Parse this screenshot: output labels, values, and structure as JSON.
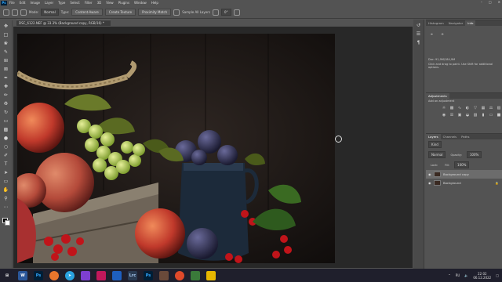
{
  "menubar": {
    "logo": "Ps",
    "items": [
      "File",
      "Edit",
      "Image",
      "Layer",
      "Type",
      "Select",
      "Filter",
      "3D",
      "View",
      "Plugins",
      "Window",
      "Help"
    ]
  },
  "options": {
    "mode_label": "Mode:",
    "mode_value": "Normal",
    "type_label": "Type:",
    "content_aware": "Content-Aware",
    "create_texture": "Create Texture",
    "proximity_match": "Proximity Match",
    "sample_all_layers": "Sample All Layers",
    "angle": "0°"
  },
  "document": {
    "tab_title": "DSC_6122.NEF @ 33.3% (Background copy, RGB/16) *",
    "zoom": "33.33%"
  },
  "history_panel": {
    "tabs": [
      "Histogram",
      "Navigator",
      "Info"
    ],
    "active_tab": 2,
    "doc_info": "Doc: 91,9M/184,9M",
    "hint": "Click and drag to paint. Use Shift for additional options."
  },
  "adjustments_panel": {
    "title": "Adjustments",
    "subtitle": "Add an adjustment"
  },
  "layers_panel": {
    "tabs": [
      "Layers",
      "Channels",
      "Paths"
    ],
    "kind_label": "Kind",
    "blend_mode": "Normal",
    "opacity_label": "Opacity:",
    "opacity_value": "100%",
    "lock_label": "Lock:",
    "fill_label": "Fill:",
    "fill_value": "100%",
    "layers": [
      {
        "name": "Background copy",
        "selected": true
      },
      {
        "name": "Background",
        "selected": false
      }
    ]
  },
  "taskbar": {
    "apps": [
      {
        "label": "⊞",
        "color": "#1f1f2c"
      },
      {
        "label": "W",
        "color": "#2b579a"
      },
      {
        "label": "Ps",
        "color": "#001e36"
      },
      {
        "label": "",
        "color": "#e8762c"
      },
      {
        "label": "➤",
        "color": "#2aa3e0"
      },
      {
        "label": "",
        "color": "#7d3fd1"
      },
      {
        "label": "",
        "color": "#c2185b"
      },
      {
        "label": "",
        "color": "#1e5fbf"
      },
      {
        "label": "Lrc",
        "color": "#2a3b52"
      },
      {
        "label": "Ps",
        "color": "#001e36"
      },
      {
        "label": "",
        "color": "#6a4a3a"
      },
      {
        "label": "",
        "color": "#e04a2a"
      },
      {
        "label": "",
        "color": "#3a7a3a"
      },
      {
        "label": "",
        "color": "#e6b600"
      }
    ],
    "language": "RU",
    "time": "22:02",
    "date": "06.12.2022"
  }
}
